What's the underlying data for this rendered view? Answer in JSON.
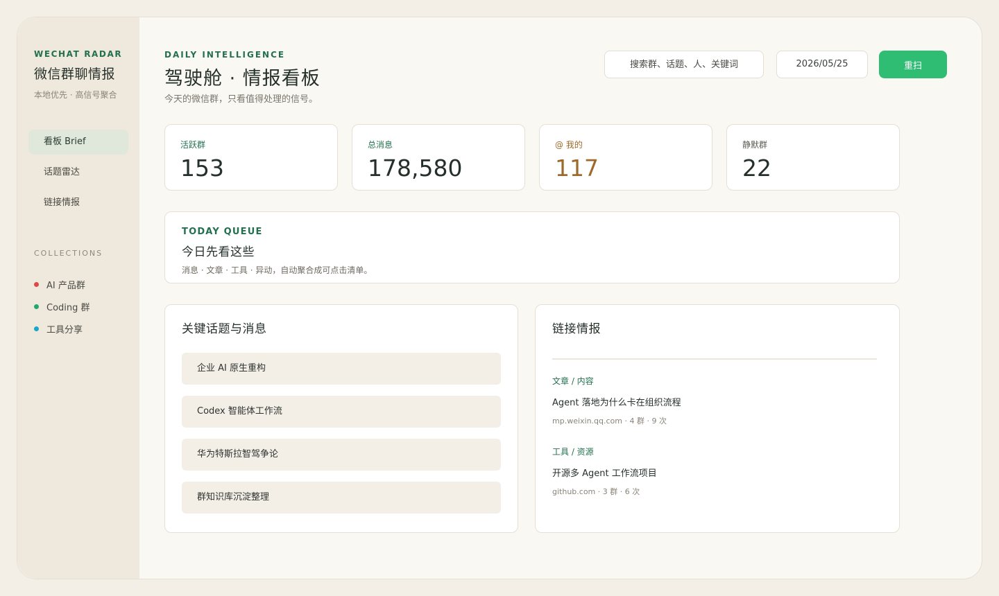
{
  "sidebar": {
    "brand_kicker": "WECHAT RADAR",
    "brand_title": "微信群聊情报",
    "brand_sub": "本地优先 · 高信号聚合",
    "nav": [
      {
        "label": "看板 Brief",
        "active": true
      },
      {
        "label": "话题雷达",
        "active": false
      },
      {
        "label": "链接情报",
        "active": false
      }
    ],
    "collections_title": "COLLECTIONS",
    "collections": [
      {
        "label": "AI 产品群",
        "color": "#e04848"
      },
      {
        "label": "Coding 群",
        "color": "#22a86a"
      },
      {
        "label": "工具分享",
        "color": "#1aa6c8"
      }
    ]
  },
  "header": {
    "kicker": "DAILY INTELLIGENCE",
    "title": "驾驶舱 · 情报看板",
    "subtitle": "今天的微信群，只看值得处理的信号。",
    "search_placeholder": "搜索群、话题、人、关键词",
    "date": "2026/05/25",
    "rescan_label": "重扫"
  },
  "stats": [
    {
      "label": "活跃群",
      "value": "153"
    },
    {
      "label": "总消息",
      "value": "178,580"
    },
    {
      "label": "@ 我的",
      "value": "117"
    },
    {
      "label": "静默群",
      "value": "22"
    }
  ],
  "queue": {
    "kicker": "TODAY QUEUE",
    "title": "今日先看这些",
    "subtitle": "消息 · 文章 · 工具 · 异动，自动聚合成可点击清单。"
  },
  "topics": {
    "title": "关键话题与消息",
    "items": [
      "企业 AI 原生重构",
      "Codex 智能体工作流",
      "华为特斯拉智驾争论",
      "群知识库沉淀整理"
    ]
  },
  "links": {
    "title": "链接情报",
    "items": [
      {
        "category": "文章 / 内容",
        "title": "Agent 落地为什么卡在组织流程",
        "meta": "mp.weixin.qq.com · 4 群 · 9 次"
      },
      {
        "category": "工具 / 资源",
        "title": "开源多 Agent 工作流项目",
        "meta": "github.com · 3 群 · 6 次"
      }
    ]
  }
}
